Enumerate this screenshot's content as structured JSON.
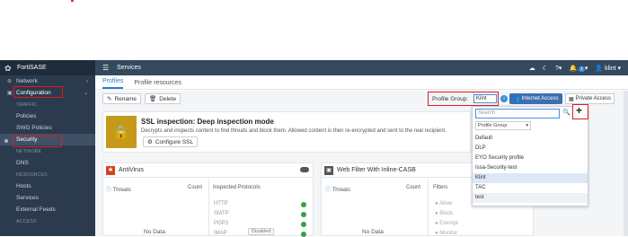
{
  "app": {
    "brand": "FortiSASE",
    "page_title": "Services"
  },
  "user": {
    "name": "klint",
    "notif_count": "1"
  },
  "sidebar": {
    "items": [
      {
        "label": "Network",
        "type": "group"
      },
      {
        "label": "Configuration",
        "type": "group"
      },
      {
        "label": "TRAFFIC",
        "type": "section"
      },
      {
        "label": "Policies",
        "type": "sub"
      },
      {
        "label": "SWG Policies",
        "type": "sub"
      },
      {
        "label": "Security",
        "type": "sub"
      },
      {
        "label": "NETWORK",
        "type": "section"
      },
      {
        "label": "DNS",
        "type": "sub"
      },
      {
        "label": "RESOURCES",
        "type": "section"
      },
      {
        "label": "Hosts",
        "type": "sub"
      },
      {
        "label": "Services",
        "type": "sub"
      },
      {
        "label": "External Feeds",
        "type": "sub"
      },
      {
        "label": "ACCESS",
        "type": "section"
      }
    ]
  },
  "tabs": [
    "Profiles",
    "Profile resources"
  ],
  "toolbar": {
    "rename": "Rename",
    "delete": "Delete"
  },
  "profile_group": {
    "label": "Profile Group:",
    "value": "Klint",
    "internet_access": "Internet Access",
    "private_access": "Private Access"
  },
  "ssl": {
    "title": "SSL inspection: Deep inspection mode",
    "desc": "Decrypts and inspects content to find threats and block them. Allowed content is then re-encrypted and sent to the real recipient.",
    "configure": "Configure SSL"
  },
  "antivirus": {
    "title": "AntiVirus",
    "threats": "Threats",
    "count": "Count",
    "protocols_title": "Inspected Protocols",
    "protocols": [
      "HTTP",
      "SMTP",
      "POP3",
      "IMAP"
    ],
    "no_data": "No Data",
    "disabled": "Disabled"
  },
  "webfilter": {
    "title": "Web Filter With Inline-CASB",
    "threats": "Threats",
    "count": "Count",
    "filters_title": "Filters",
    "filters": [
      "Allow",
      "Block",
      "Exempt",
      "Monitor"
    ],
    "no_data": "No Data"
  },
  "dropdown": {
    "search_placeholder": "Search",
    "group_select": "Profile Group",
    "items": [
      "Default",
      "DLP",
      "EYO Security profile",
      "Issa-Security-test",
      "Klint",
      "TAC",
      "test"
    ],
    "selected": "Klint"
  },
  "colors": {
    "accent": "#3b8fd9",
    "sidebar_bg": "#2b3a4d",
    "highlight_box": "#e01b24"
  }
}
